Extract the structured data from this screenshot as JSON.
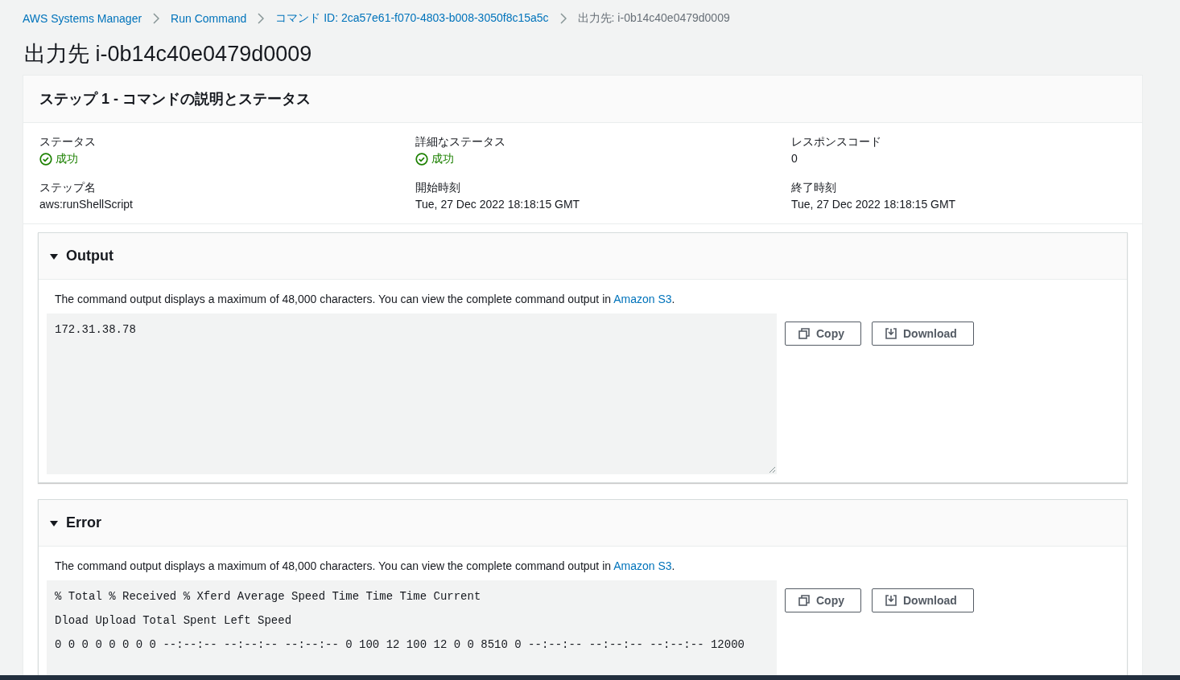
{
  "breadcrumbs": [
    {
      "label": "AWS Systems Manager",
      "link": true
    },
    {
      "label": "Run Command",
      "link": true
    },
    {
      "label": "コマンド ID: 2ca57e61-f070-4803-b008-3050f8c15a5c",
      "link": true
    },
    {
      "label": "出力先: i-0b14c40e0479d0009",
      "link": false
    }
  ],
  "page_title": "出力先 i-0b14c40e0479d0009",
  "step_card": {
    "title": "ステップ 1 - コマンドの説明とステータス",
    "fields": [
      {
        "label": "ステータス",
        "value": "成功",
        "kind": "status"
      },
      {
        "label": "詳細なステータス",
        "value": "成功",
        "kind": "status"
      },
      {
        "label": "レスポンスコード",
        "value": "0",
        "kind": "text"
      },
      {
        "label": "ステップ名",
        "value": "aws:runShellScript",
        "kind": "text"
      },
      {
        "label": "開始時刻",
        "value": "Tue, 27 Dec 2022 18:18:15 GMT",
        "kind": "text"
      },
      {
        "label": "終了時刻",
        "value": "Tue, 27 Dec 2022 18:18:15 GMT",
        "kind": "text"
      }
    ]
  },
  "sections": [
    {
      "title": "Output",
      "expanded": true,
      "note": "The command output displays a maximum of 48,000 characters. You can view the complete command output in",
      "link": "Amazon S3",
      "note_end": ".",
      "lines": [
        "172.31.38.78"
      ],
      "buttons": [
        "Copy",
        "Download"
      ]
    },
    {
      "title": "Error",
      "expanded": true,
      "note": "The command output displays a maximum of 48,000 characters. You can view the complete command output in",
      "link": "Amazon S3",
      "note_end": ".",
      "lines": [
        "% Total % Received % Xferd Average Speed Time Time Time Current",
        "Dload Upload Total Spent Left Speed",
        "0 0 0 0 0 0 0 0 --:--:-- --:--:-- --:--:-- 0 100 12 100 12 0 0 8510 0 --:--:-- --:--:-- --:--:-- 12000"
      ],
      "buttons": [
        "Copy",
        "Download"
      ]
    }
  ]
}
